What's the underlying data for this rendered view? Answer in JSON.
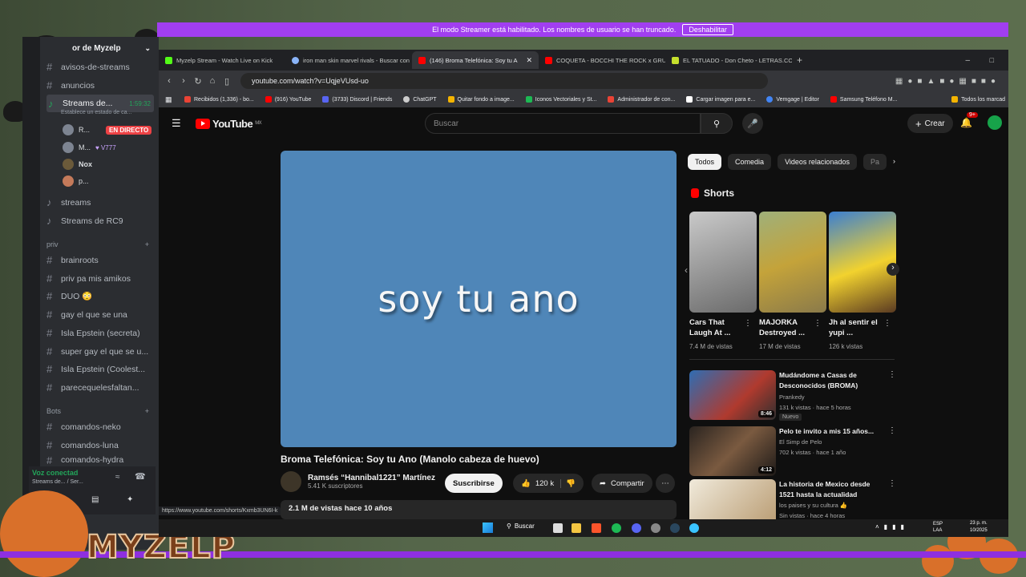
{
  "streamer_bar": {
    "message": "El modo Streamer está habilitado. Los nombres de usuario se han truncado.",
    "button": "Deshabilitar"
  },
  "discord": {
    "server_name": "or de Myzelp",
    "channels_top": [
      {
        "name": "avisos-de-streams"
      },
      {
        "name": "anuncios"
      }
    ],
    "active_voice": {
      "name": "Streams de...",
      "time": "1:59:32",
      "status_hint": "Establece un estado de ca..."
    },
    "voice_users": [
      {
        "name": "R...",
        "badge": "EN DIRECTO"
      },
      {
        "name": "M...",
        "extra": "♥ V777"
      },
      {
        "name": "Nox"
      },
      {
        "name": "p..."
      }
    ],
    "channels_mid": [
      {
        "name": "streams"
      },
      {
        "name": "Streams de RC9"
      }
    ],
    "category_priv": "priv",
    "channels_priv": [
      {
        "name": "brainroots"
      },
      {
        "name": "priv pa mis amikos"
      },
      {
        "name": "DUO 😳"
      },
      {
        "name": "gay el que se una"
      },
      {
        "name": "Isla Epstein (secreta)"
      },
      {
        "name": "super gay el que se u..."
      },
      {
        "name": "Isla Epstein (Coolest..."
      },
      {
        "name": "parecequelesfaltan..."
      }
    ],
    "category_bots": "Bots",
    "channels_bots": [
      {
        "name": "comandos-neko"
      },
      {
        "name": "comandos-luna"
      },
      {
        "name": "comandos-hydra"
      }
    ],
    "voice_connected": "Voz conectad",
    "voice_connected_sub": "Streams de... / Ser..."
  },
  "overlay_text": "MYZELP",
  "browser": {
    "tabs": [
      {
        "label": "Myzelp Stream - Watch Live on Kick",
        "color": "#53fc18"
      },
      {
        "label": "iron man skin marvel rivals - Buscar con",
        "color": "#8ab4f8"
      },
      {
        "label": "(146) Broma Telefónica: Soy tu A",
        "color": "#ff0000"
      },
      {
        "label": "COQUETA - BOCCHI THE ROCK x GRUP...",
        "color": "#ff0000"
      },
      {
        "label": "EL TATUADO - Don Cheto - LETRAS.COM",
        "color": "#c6e02d"
      }
    ],
    "url": "youtube.com/watch?v=UqjeVUsd-uo",
    "bookmarks": [
      {
        "label": "Recibidos (1,336) - bo...",
        "color": "#ea4335"
      },
      {
        "label": "(916) YouTube",
        "color": "#ff0000"
      },
      {
        "label": "(3733) Discord | Friends",
        "color": "#5865f2"
      },
      {
        "label": "ChatGPT",
        "color": "#cccccc"
      },
      {
        "label": "Quitar fondo a image...",
        "color": "#f4b400"
      },
      {
        "label": "Iconos Vectoriales y St...",
        "color": "#1db954"
      },
      {
        "label": "Administrador de con...",
        "color": "#ea4335"
      },
      {
        "label": "Cargar imagen para e...",
        "color": "#ffffff"
      },
      {
        "label": "Vemgage | Editor",
        "color": "#4285f4"
      },
      {
        "label": "Samsung Teléfono M...",
        "color": "#ff0000"
      }
    ],
    "bookmarks_right": "Todos los marcad"
  },
  "youtube": {
    "logo": "YouTube",
    "region": "MX",
    "search_placeholder": "Buscar",
    "create": "Crear",
    "notif_count": "9+",
    "video_caption": "soy tu ano",
    "title": "Broma Telefónica: Soy tu Ano (Manolo cabeza de huevo)",
    "channel": "Ramsés “Hannibal1221” Martínez",
    "subscribers": "5.41 K suscriptores",
    "subscribe": "Suscribirse",
    "likes": "120 k",
    "share": "Compartir",
    "views_line": "2.1 M de vistas  hace 10 años",
    "status_url": "https://www.youtube.com/shorts/Kxmb3UN6I-k",
    "chips": [
      "Todos",
      "Comedia",
      "Videos relacionados",
      "Pa"
    ],
    "shorts_title": "Shorts",
    "shorts": [
      {
        "title": "Cars That Laugh At ...",
        "views": "7.4 M de vistas",
        "color": "#9a9a9a"
      },
      {
        "title": "MAJORKA Destroyed ...",
        "views": "17 M de vistas",
        "color": "#8a7a4a"
      },
      {
        "title": "Jh al sentir el yupi ...",
        "views": "126 k vistas",
        "color": "#c88a2e"
      }
    ],
    "recommendations": [
      {
        "title": "Mudándome a Casas de Desconocidos (BROMA)",
        "channel": "Prankedy",
        "meta": "131 k vistas · hace 5 horas",
        "badge": "Nuevo",
        "duration": "8:46",
        "color": "#3d7bc4"
      },
      {
        "title": "Pelo te invito a mis 15 años...",
        "channel": "El Simp de Pelo",
        "meta": "702 k vistas · hace 1 año",
        "duration": "4:12",
        "color": "#4a3a2e"
      },
      {
        "title": "La historia de Mexico desde 1521 hasta la actualidad",
        "channel": "los paises y su cultura 👍",
        "meta": "Sin vistas · hace 4 horas",
        "color": "#d8d0c0"
      }
    ]
  },
  "taskbar": {
    "search": "Buscar",
    "tray_lang": "ESP LAA",
    "time": "23 p. m.",
    "date": "10/2025"
  }
}
